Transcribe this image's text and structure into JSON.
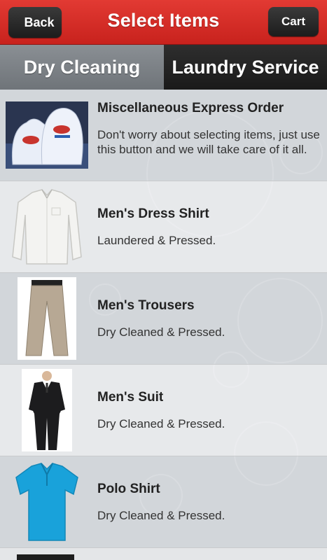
{
  "header": {
    "title": "Select Items",
    "back_label": "Back",
    "cart_label": "Cart"
  },
  "tabs": [
    {
      "label": "Dry Cleaning",
      "active": false
    },
    {
      "label": "Laundry Service",
      "active": true
    }
  ],
  "items": [
    {
      "title": "Miscellaneous Express Order",
      "description": "Don't worry about selecting items, just use this button and we will take care of it all.",
      "icon": "laundry-bags-image"
    },
    {
      "title": "Men's Dress Shirt",
      "description": "Laundered & Pressed.",
      "icon": "dress-shirt-image"
    },
    {
      "title": "Men's Trousers",
      "description": "Dry Cleaned & Pressed.",
      "icon": "trousers-image"
    },
    {
      "title": "Men's Suit",
      "description": "Dry Cleaned & Pressed.",
      "icon": "suit-image"
    },
    {
      "title": "Polo Shirt",
      "description": "Dry Cleaned & Pressed.",
      "icon": "polo-shirt-image"
    }
  ],
  "colors": {
    "header_red": "#d42a24",
    "button_dark": "#262626",
    "tab_inactive": "#7d8287",
    "tab_active": "#222222",
    "polo_blue": "#1aa3dc"
  }
}
